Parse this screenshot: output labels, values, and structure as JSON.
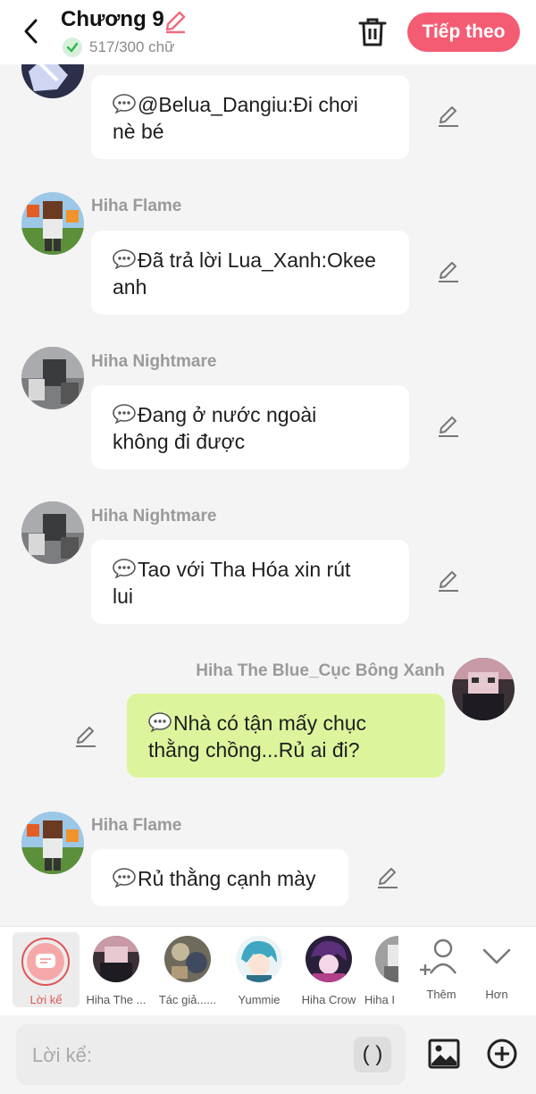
{
  "header": {
    "title": "Chương 9",
    "word_count": "517/300 chữ",
    "next_label": "Tiếp theo"
  },
  "messages": [
    {
      "sender": "",
      "text": "@Belua_Dangiu:Đi chơi nè bé",
      "line1": "@Belua_Dangiu:Đi chơi",
      "line2": "nè bé"
    },
    {
      "sender": "Hiha Flame",
      "line1": "Đã trả lời Lua_Xanh:Okee",
      "line2": "anh"
    },
    {
      "sender": "Hiha Nightmare",
      "line1": "Đang ở nước ngoài",
      "line2": "không đi được"
    },
    {
      "sender": "Hiha Nightmare",
      "line1": "Tao với Tha Hóa xin rút",
      "line2": "lui"
    },
    {
      "sender": "Hiha The Blue_Cục Bông Xanh",
      "line1": "Nhà có tận mấy chục",
      "line2": "thằng chồng...Rủ ai đi?"
    },
    {
      "sender": "Hiha Flame",
      "line1": "Rủ thằng cạnh mày"
    }
  ],
  "characters": [
    {
      "label": "Lời kể"
    },
    {
      "label": "Hiha The ..."
    },
    {
      "label": "Tác giả......"
    },
    {
      "label": "Yummie"
    },
    {
      "label": "Hiha Crow"
    },
    {
      "label": "Hiha I"
    }
  ],
  "tools": {
    "add_label": "Thêm",
    "more_label": "Hơn"
  },
  "input": {
    "placeholder": "Lời kể:",
    "paren_label": "( )"
  },
  "colors": {
    "accent": "#f45c74",
    "my_bubble": "#dcf59c",
    "narration_red": "#e05656"
  }
}
